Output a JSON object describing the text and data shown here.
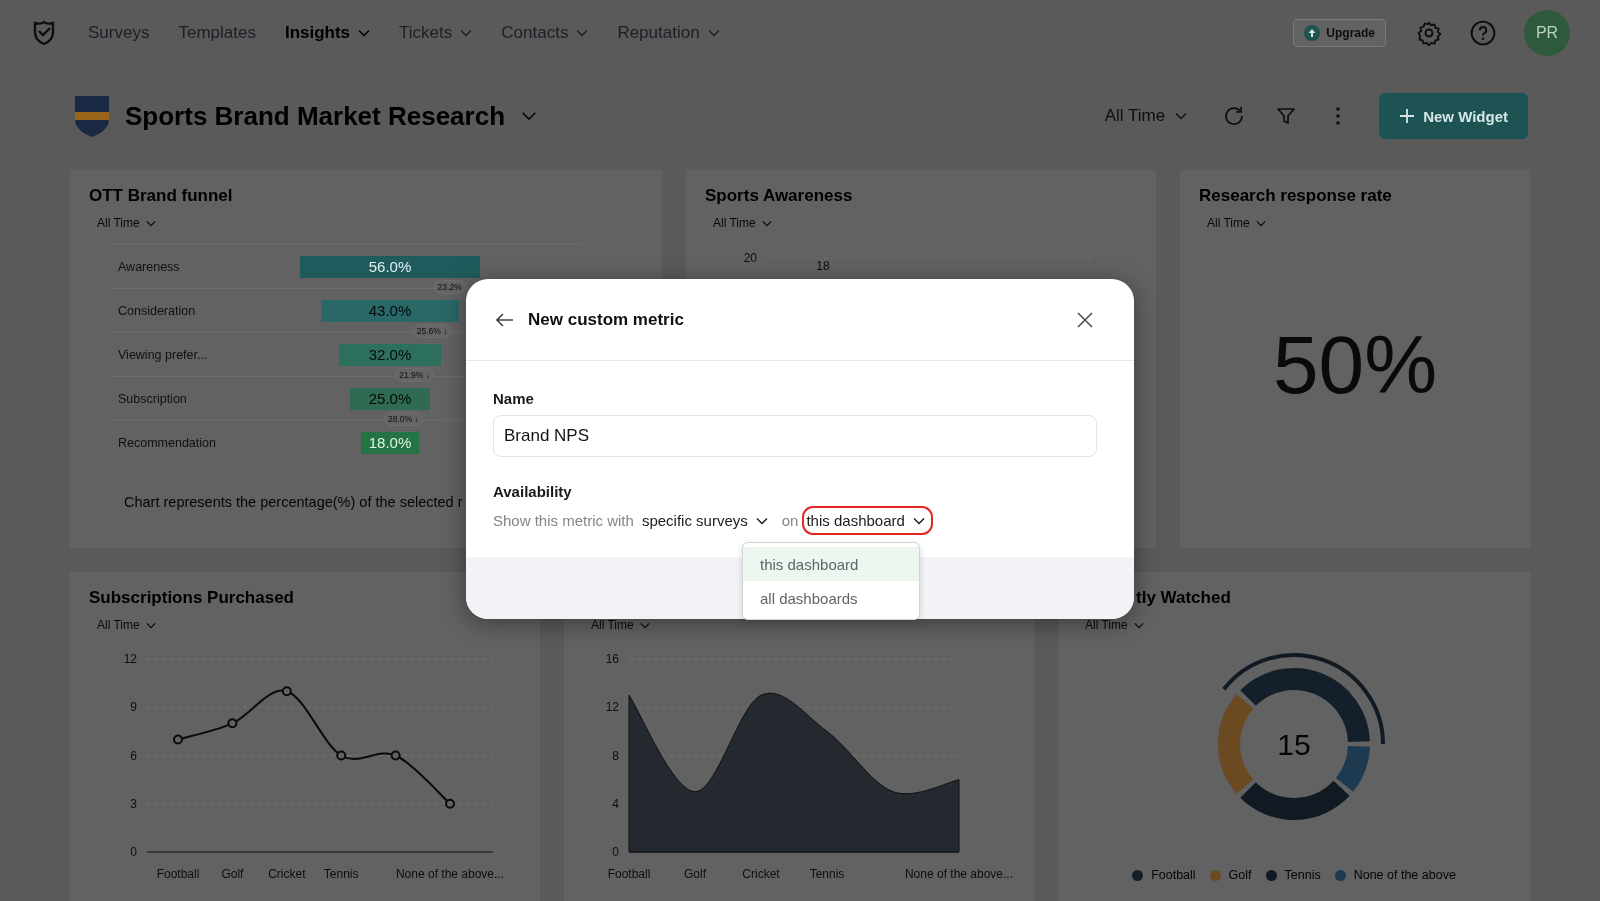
{
  "nav": {
    "items": [
      {
        "label": "Surveys",
        "selected": false,
        "dropdown": false
      },
      {
        "label": "Templates",
        "selected": false,
        "dropdown": false
      },
      {
        "label": "Insights",
        "selected": true,
        "dropdown": true
      },
      {
        "label": "Tickets",
        "selected": false,
        "dropdown": true
      },
      {
        "label": "Contacts",
        "selected": false,
        "dropdown": true
      },
      {
        "label": "Reputation",
        "selected": false,
        "dropdown": true
      }
    ],
    "upgrade": "Upgrade",
    "avatar": "PR"
  },
  "dashboard": {
    "title": "Sports Brand Market Research",
    "period": "All Time",
    "new_widget": "New Widget"
  },
  "widgets": [
    {
      "kind": "funnel",
      "title": "OTT Brand funnel",
      "period": "All Time",
      "stages": [
        {
          "label": "Awareness",
          "value": "56.0%",
          "drop": "23.2%"
        },
        {
          "label": "Consideration",
          "value": "43.0%",
          "drop": "25.6% ↓"
        },
        {
          "label": "Viewing prefer...",
          "value": "32.0%",
          "drop": "21.9% ↓"
        },
        {
          "label": "Subscription",
          "value": "25.0%",
          "drop": "28.0% ↓"
        },
        {
          "label": "Recommendation",
          "value": "18.0%"
        }
      ],
      "caption": "Chart represents the percentage(%) of the selected r"
    },
    {
      "kind": "partial",
      "title": "Sports Awareness",
      "period": "All Time",
      "y_tick": "20",
      "value_label": "18"
    },
    {
      "kind": "stat",
      "title": "Research response rate",
      "period": "All Time",
      "value": "50%"
    },
    {
      "kind": "line",
      "title": "Subscriptions Purchased",
      "period": "All Time",
      "chart_data": {
        "type": "line",
        "categories": [
          "Football",
          "Golf",
          "Cricket",
          "Tennis",
          null,
          "None of the above..."
        ],
        "ylim": [
          0,
          12
        ],
        "yticks": [
          0,
          3,
          6,
          9,
          12
        ],
        "grid": true,
        "series": [
          {
            "color": "#0a0a0a",
            "marker": "o",
            "values": [
              7,
              8,
              10,
              6,
              6,
              3
            ]
          }
        ]
      }
    },
    {
      "kind": "area",
      "period": "All Time",
      "chart_data": {
        "type": "area",
        "categories": [
          "Football",
          "Golf",
          "Cricket",
          "Tennis",
          null,
          "None of the above..."
        ],
        "ylim": [
          0,
          16
        ],
        "yticks": [
          0,
          4,
          8,
          12,
          16
        ],
        "grid": true,
        "series": [
          {
            "color": "#23292e",
            "values": [
              13,
              5,
              13,
              10,
              5,
              6
            ]
          }
        ]
      }
    },
    {
      "kind": "donut",
      "title": "tly Watched",
      "period": "All Time",
      "total": "15",
      "legend": [
        {
          "label": "Football",
          "color": "#13202b"
        },
        {
          "label": "Golf",
          "color": "#6b4a22"
        },
        {
          "label": "Tennis",
          "color": "#111a22"
        },
        {
          "label": "None of the above",
          "color": "#1d3a50"
        }
      ]
    }
  ],
  "modal": {
    "title": "New custom metric",
    "name_label": "Name",
    "name_value": "Brand NPS",
    "availability_label": "Availability",
    "sentence_start": "Show this metric with",
    "surveys_choice": "specific surveys",
    "connector": "on",
    "dashboard_choice": "this dashboard",
    "dashboard_highlighted": true,
    "menu": [
      {
        "label": "this dashboard",
        "selected": true
      },
      {
        "label": "all dashboards",
        "selected": false
      }
    ]
  }
}
